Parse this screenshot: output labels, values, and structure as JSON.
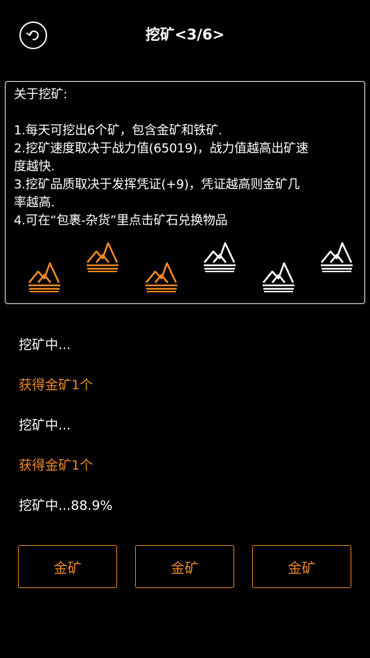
{
  "header": {
    "title": "挖矿<3/6>",
    "back_icon": "back-arrow-icon"
  },
  "info": {
    "heading": "关于挖矿:",
    "lines": [
      "1.每天可挖出6个矿，包含金矿和铁矿.",
      "2.挖矿速度取决于战力值(65019)，战力值越高出矿速",
      "度越快.",
      "3.挖矿品质取决于发挥凭证(+9)，凭证越高则金矿几",
      "率越高.",
      "4.可在“包裹-杂货”里点击矿石兑换物品"
    ],
    "mountains": [
      {
        "kind": "gold",
        "color": "#f08a24"
      },
      {
        "kind": "gold",
        "color": "#f08a24"
      },
      {
        "kind": "gold",
        "color": "#f08a24"
      },
      {
        "kind": "iron",
        "color": "#ffffff"
      },
      {
        "kind": "iron",
        "color": "#ffffff"
      },
      {
        "kind": "iron",
        "color": "#ffffff"
      }
    ]
  },
  "log": [
    {
      "text": "挖矿中...",
      "color": "#ffffff"
    },
    {
      "text": "获得金矿1个",
      "color": "#f08a24"
    },
    {
      "text": "挖矿中...",
      "color": "#ffffff"
    },
    {
      "text": "获得金矿1个",
      "color": "#f08a24"
    },
    {
      "text": "挖矿中...88.9%",
      "color": "#ffffff"
    }
  ],
  "buttons": [
    {
      "label": "金矿"
    },
    {
      "label": "金矿"
    },
    {
      "label": "金矿"
    }
  ],
  "colors": {
    "background": "#000000",
    "accent": "#f08a24",
    "text": "#ffffff"
  }
}
